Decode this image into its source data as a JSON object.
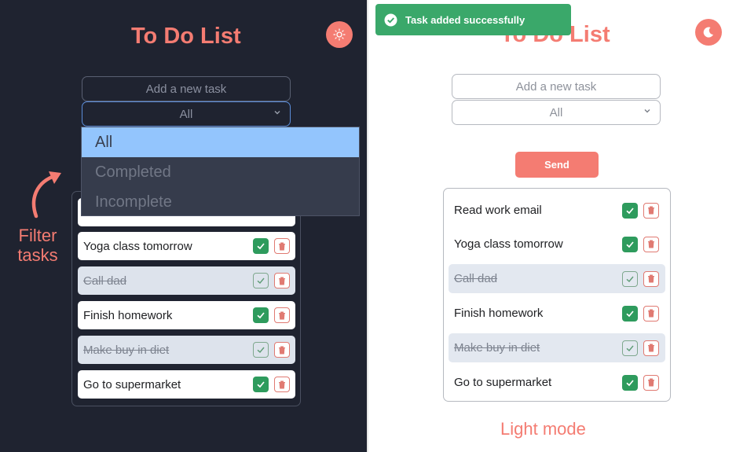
{
  "app": {
    "title": "To Do List",
    "task_placeholder": "Add a new task",
    "filter_value": "All"
  },
  "dark_panel": {
    "filter_options": [
      "All",
      "Completed",
      "Incomplete"
    ],
    "selected_filter": "All",
    "annotation": [
      "Filter",
      "tasks"
    ],
    "tasks": [
      {
        "text": "",
        "completed": false
      },
      {
        "text": "Yoga class tomorrow",
        "completed": false
      },
      {
        "text": "Call dad",
        "completed": true
      },
      {
        "text": "Finish homework",
        "completed": false
      },
      {
        "text": "Make buy in diet",
        "completed": true
      },
      {
        "text": "Go to supermarket",
        "completed": false
      }
    ]
  },
  "light_panel": {
    "send_label": "Send",
    "toast": "Task added successfully",
    "annotation": "Light mode",
    "tasks": [
      {
        "text": "Read work email",
        "completed": false
      },
      {
        "text": "Yoga class tomorrow",
        "completed": false
      },
      {
        "text": "Call dad",
        "completed": true
      },
      {
        "text": "Finish homework",
        "completed": false
      },
      {
        "text": "Make buy in diet",
        "completed": true
      },
      {
        "text": "Go to supermarket",
        "completed": false
      }
    ]
  },
  "colors": {
    "accent": "#f47c72",
    "dark_bg": "#1f2330",
    "check_green": "#2e9b5d",
    "toast_green": "#3aa86a",
    "dropdown_selected": "#93c5fd"
  },
  "icons": [
    "sun-icon",
    "moon-icon",
    "chevron-down-icon",
    "check-icon",
    "trash-icon",
    "check-circle-icon",
    "curved-arrow-icon"
  ]
}
